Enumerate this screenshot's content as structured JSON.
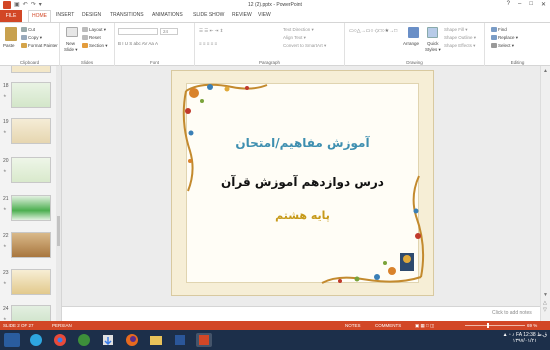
{
  "titlebar": {
    "title": "12 (2).pptx - PowerPoint",
    "qat": [
      "↶",
      "↷",
      "▣",
      "▾"
    ],
    "help": "?",
    "minimize": "–",
    "restore": "□",
    "close": "✕"
  },
  "tabs": [
    "FILE",
    "HOME",
    "INSERT",
    "DESIGN",
    "TRANSITIONS",
    "ANIMATIONS",
    "SLIDE SHOW",
    "REVIEW",
    "VIEW"
  ],
  "ribbon": {
    "clipboard": {
      "paste": "Paste",
      "cut": "Cut",
      "copy": "Copy ▾",
      "format_painter": "Format Painter",
      "group": "Clipboard"
    },
    "slides": {
      "new_slide": "New",
      "new_slide2": "Slide ▾",
      "layout": "Layout ▾",
      "reset": "Reset",
      "section": "Section ▾",
      "group": "Slides"
    },
    "font": {
      "size": "24",
      "group": "Font"
    },
    "paragraph": {
      "text_direction": "Text Direction ▾",
      "align_text": "Align Text ▾",
      "smartart": "Convert to SmartArt ▾",
      "group": "Paragraph"
    },
    "drawing": {
      "arrange": "Arrange",
      "quick_styles": "Quick",
      "quick_styles2": "Styles ▾",
      "shape_fill": "Shape Fill ▾",
      "shape_outline": "Shape Outline ▾",
      "shape_effects": "Shape Effects ▾",
      "group": "Drawing"
    },
    "editing": {
      "find": "Find",
      "replace": "Replace ▾",
      "select": "Select ▾",
      "group": "Editing"
    }
  },
  "thumbnails": [
    {
      "num": "18",
      "star": "★"
    },
    {
      "num": "19",
      "star": "★"
    },
    {
      "num": "20",
      "star": "★"
    },
    {
      "num": "21",
      "star": "★"
    },
    {
      "num": "22",
      "star": "★"
    },
    {
      "num": "23",
      "star": "★"
    },
    {
      "num": "24",
      "star": "★"
    }
  ],
  "slide": {
    "line1": "آموزش مفاهیم/امتحان",
    "line2": "درس دوازدهم آموزش قرآن",
    "line3": "پایه هشتم"
  },
  "notes_placeholder": "Click to add notes",
  "status": {
    "slide": "SLIDE 2 OF 27",
    "language": "PERSIAN",
    "notes": "NOTES",
    "comments": "COMMENTS",
    "zoom": "69 %"
  },
  "taskbar": {
    "lang": "FA",
    "time": "12:38 ق.ظ",
    "date": "۱۳۹۷/۰۱/۲۱"
  },
  "colors": {
    "accent": "#d24726",
    "taskbar": "#1c2f4a"
  }
}
